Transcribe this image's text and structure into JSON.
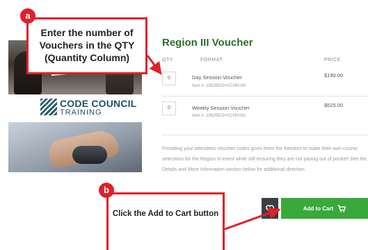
{
  "product": {
    "title": "Region III Voucher",
    "columns": {
      "qty": "QTY",
      "format": "FORMAT",
      "price": "PRICE"
    },
    "rows": [
      {
        "qty": "0",
        "format": "Day Session Voucher",
        "item": "Item #: 1952REGVVCHR190",
        "price": "$190.00"
      },
      {
        "qty": "0",
        "format": "Weekly Session Voucher",
        "item": "Item #: 1952REGVVCHR191",
        "price": "$625.00"
      }
    ],
    "description": "Providing your attendees Voucher codes gives them the freedom to make their own course selections for the Region III event while still ensuring they are not paying out of pocket! See the Details and More Information section below for additional direction."
  },
  "logo": {
    "name": "CODE COUNCIL",
    "sub": "TRAINING"
  },
  "actions": {
    "add_to_cart": "Add to Cart",
    "wishlist_icon": "heart-icon",
    "cart_icon": "cart-icon"
  },
  "callouts": {
    "a": {
      "badge": "a",
      "text": "Enter the number of Vouchers in the QTY (Quantity Column)"
    },
    "b": {
      "badge": "b",
      "text": "Click the Add to Cart button"
    }
  },
  "colors": {
    "accent_green": "#3aa83a",
    "title_green": "#2e6b2a",
    "callout_red": "#e0202a",
    "logo_teal": "#1f5162"
  }
}
